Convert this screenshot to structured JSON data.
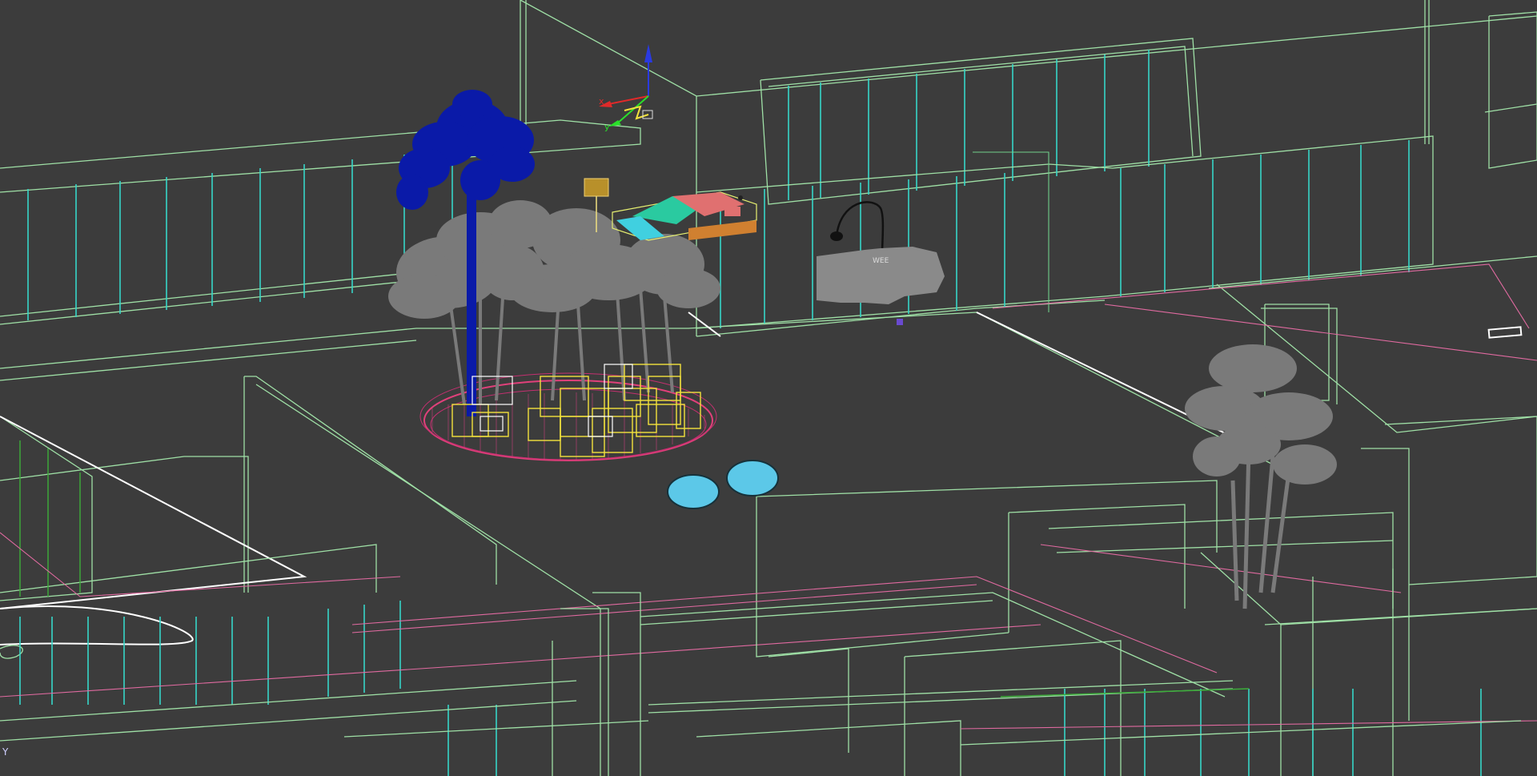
{
  "viewport": {
    "type": "wireframe",
    "background_color": "#3c3c3c"
  },
  "objects": [
    {
      "name": "palm-tree",
      "color": "#0a1aa8"
    },
    {
      "name": "gray-tree-cluster",
      "color": "#7a7a7a"
    },
    {
      "name": "gray-tree-right",
      "color": "#7a7a7a"
    },
    {
      "name": "planter-ring",
      "color": "#e0407a"
    },
    {
      "name": "yellow-boxes",
      "color": "#f2e23c"
    },
    {
      "name": "blue-stones",
      "color": "#5cc8e8"
    },
    {
      "name": "bed-furniture",
      "color": "#e07070"
    },
    {
      "name": "gray-sofa",
      "color": "#8a8a8a"
    },
    {
      "name": "floor-lamp",
      "color": "#111111"
    },
    {
      "name": "gold-lamp",
      "color": "#b8902a"
    }
  ],
  "gizmo": {
    "x_axis_label": "x",
    "y_axis_label": "y",
    "z_axis_color": "#2a3ae0",
    "x_axis_color": "#e02a2a",
    "y_axis_color": "#2ae02a"
  },
  "sofa_label": "WEE",
  "corner_axis_label": "Y"
}
